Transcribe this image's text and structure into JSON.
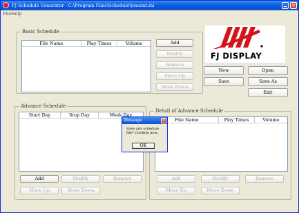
{
  "window": {
    "title": "FJ Schedule Generator - C:\\Program Files\\Schedule\\yeasmt.ini",
    "close_glyph": "✕"
  },
  "menu": {
    "items": [
      "File",
      "Help"
    ]
  },
  "basic_schedule": {
    "label": "Basic Schedule",
    "columns": [
      "File Name",
      "Play Times",
      "Volume"
    ],
    "buttons": {
      "add": "Add",
      "modify": "Modify",
      "remove": "Remove",
      "move_up": "Move Up",
      "move_down": "Move Down"
    }
  },
  "logo": {
    "text": "FJ DISPLAY",
    "brand_color": "#d4141c"
  },
  "file_buttons": {
    "new": "New",
    "open": "Open",
    "save": "Save",
    "save_as": "Save As",
    "exit": "Exit"
  },
  "advance_schedule": {
    "label": "Advance Schedule",
    "columns": [
      "Start Day",
      "Stop Day",
      "Week Day"
    ],
    "buttons": {
      "add": "Add",
      "modify": "Modify",
      "remove": "Remove",
      "move_up": "Move Up",
      "move_down": "Move Down"
    }
  },
  "detail_schedule": {
    "label": "Detail of Advance Schedule",
    "columns": [
      "File Name",
      "Play Times",
      "Volume"
    ],
    "buttons": {
      "add": "Add",
      "modify": "Modify",
      "remove": "Remove",
      "move_up": "Move Up",
      "move_down": "Move Down"
    }
  },
  "message_dialog": {
    "title": "Message",
    "text": "Save any schedule file? Confirm now.",
    "ok_label": "OK",
    "close_glyph": "✕"
  }
}
